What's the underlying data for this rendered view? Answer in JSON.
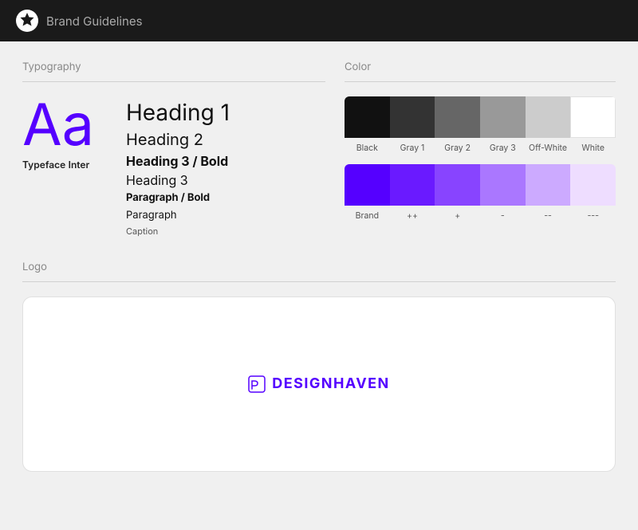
{
  "nav": {
    "brand_bold": "Brand",
    "brand_light": " Guidelines"
  },
  "typography": {
    "section_title": "Typography",
    "big_letters": "Aa",
    "typeface_label": "Typeface",
    "typeface_name": "Inter",
    "h1": "Heading 1",
    "h2": "Heading 2",
    "h3_bold": "Heading 3 / Bold",
    "h3": "Heading 3",
    "paragraph_bold": "Paragraph / Bold",
    "paragraph": "Paragraph",
    "caption": "Caption"
  },
  "color": {
    "section_title": "Color",
    "neutrals": [
      {
        "name": "Black",
        "hex": "#111111"
      },
      {
        "name": "Gray 1",
        "hex": "#333333"
      },
      {
        "name": "Gray 2",
        "hex": "#666666"
      },
      {
        "name": "Gray 3",
        "hex": "#999999"
      },
      {
        "name": "Off-White",
        "hex": "#cccccc"
      },
      {
        "name": "White",
        "hex": "#ffffff"
      }
    ],
    "brand_colors": [
      {
        "name": "Brand",
        "hex": "#5500ff"
      },
      {
        "name": "++",
        "hex": "#6a1aff"
      },
      {
        "name": "+",
        "hex": "#8844ff"
      },
      {
        "name": "-",
        "hex": "#aa77ff"
      },
      {
        "name": "--",
        "hex": "#ccaaff"
      },
      {
        "name": "---",
        "hex": "#eeddff"
      }
    ]
  },
  "logo": {
    "section_title": "Logo",
    "logo_text": "DESIGNHAVEN"
  }
}
